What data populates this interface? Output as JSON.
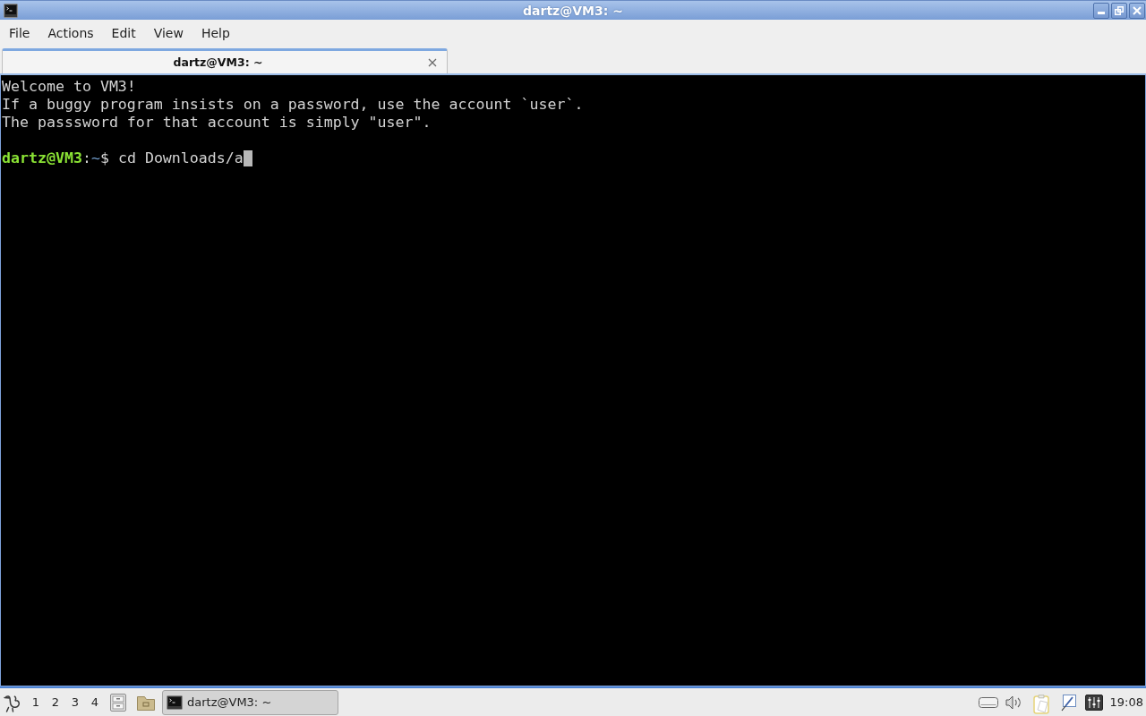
{
  "window": {
    "title": "dartz@VM3: ~"
  },
  "menu_bar": [
    "File",
    "Actions",
    "Edit",
    "View",
    "Help"
  ],
  "tabs": [
    {
      "label": "dartz@VM3: ~",
      "selected": true
    }
  ],
  "terminal": {
    "lines": [
      {
        "kind": "output",
        "text": "Welcome to VM3!"
      },
      {
        "kind": "output",
        "text": "If a buggy program insists on a password, use the account `user`."
      },
      {
        "kind": "output",
        "text": "The passsword for that account is simply \"user\"."
      },
      {
        "kind": "blank"
      },
      {
        "kind": "prompt",
        "user_host": "dartz@VM3",
        "separator": ":",
        "path": "~",
        "symbol": "$",
        "command": "cd Downloads/a",
        "cursor": true
      }
    ]
  },
  "taskbar": {
    "workspaces": [
      "1",
      "2",
      "3",
      "4"
    ],
    "tasks": [
      {
        "label": "dartz@VM3: ~",
        "selected": true
      }
    ],
    "clock": "19:08"
  }
}
